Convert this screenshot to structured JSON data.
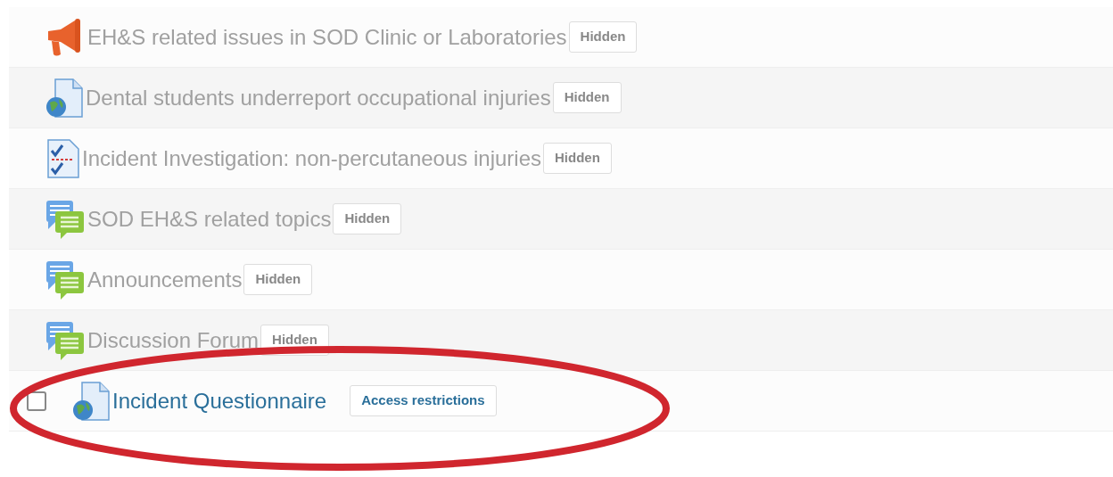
{
  "activities": [
    {
      "kind": "megaphone",
      "title": "EH&S related issues in SOD Clinic or Laboratories",
      "badge": "Hidden",
      "dimmed": true
    },
    {
      "kind": "url",
      "title": "Dental students underreport occupational injuries",
      "badge": "Hidden",
      "dimmed": true
    },
    {
      "kind": "quiz",
      "title": "Incident Investigation: non-percutaneous injuries",
      "badge": "Hidden",
      "dimmed": true
    },
    {
      "kind": "forum",
      "title": "SOD EH&S related topics",
      "badge": "Hidden",
      "dimmed": true
    },
    {
      "kind": "forum",
      "title": "Announcements",
      "badge": "Hidden",
      "dimmed": true
    },
    {
      "kind": "forum",
      "title": "Discussion Forum",
      "badge": "Hidden",
      "dimmed": true
    },
    {
      "kind": "url",
      "title": "Incident Questionnaire",
      "badge": "Access restrictions",
      "dimmed": false,
      "checkbox": {
        "checked": false
      }
    }
  ]
}
